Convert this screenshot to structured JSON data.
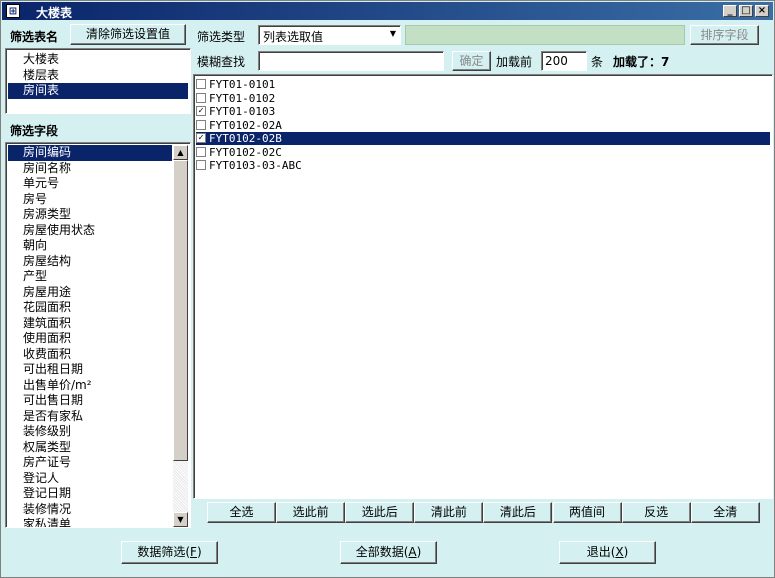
{
  "window": {
    "title": "大楼表",
    "icon": "app-icon",
    "min": "_",
    "max": "□",
    "close": "×"
  },
  "left": {
    "table_label": "筛选表名",
    "clear_button": "清除筛选设置值",
    "tables": [
      "大楼表",
      "楼层表",
      "房间表"
    ],
    "selected_table": 2,
    "field_label": "筛选字段",
    "fields": [
      "房间编码",
      "房间名称",
      "单元号",
      "房号",
      "房源类型",
      "房屋使用状态",
      "朝向",
      "房屋结构",
      "产型",
      "房屋用途",
      "花园面积",
      "建筑面积",
      "使用面积",
      "收费面积",
      "可出租日期",
      "出售单价/m²",
      "可出售日期",
      "是否有家私",
      "装修级别",
      "权属类型",
      "房产证号",
      "登记人",
      "登记日期",
      "装修情况",
      "家私清单"
    ],
    "selected_field": 0
  },
  "filter": {
    "type_label": "筛选类型",
    "type_value": "列表选取值",
    "sort_button": "排序字段",
    "fuzzy_label": "模糊查找",
    "fuzzy_value": "",
    "confirm_button": "确定",
    "load_prefix": "加载前",
    "load_count": "200",
    "load_unit": "条",
    "loaded_label": "加载了：",
    "loaded_count": "7"
  },
  "values": [
    {
      "text": "FYT01-0101",
      "checked": false,
      "selected": false
    },
    {
      "text": "FYT01-0102",
      "checked": false,
      "selected": false
    },
    {
      "text": "FYT01-0103",
      "checked": true,
      "selected": false
    },
    {
      "text": "FYT0102-02A",
      "checked": false,
      "selected": false
    },
    {
      "text": "FYT0102-02B",
      "checked": true,
      "selected": true
    },
    {
      "text": "FYT0102-02C",
      "checked": false,
      "selected": false
    },
    {
      "text": "FYT0103-03-ABC",
      "checked": false,
      "selected": false
    }
  ],
  "actions": [
    "全选",
    "选此前",
    "选此后",
    "清此前",
    "清此后",
    "两值间",
    "反选",
    "全清"
  ],
  "footer": {
    "filter_btn": "数据筛选",
    "filter_key": "F",
    "all_btn": "全部数据",
    "all_key": "A",
    "exit_btn": "退出",
    "exit_key": "X"
  },
  "colors": {
    "bg": "#D4F0F0",
    "select": "#0A246A",
    "title_start": "#0A246A",
    "title_end": "#3A6EA5"
  }
}
